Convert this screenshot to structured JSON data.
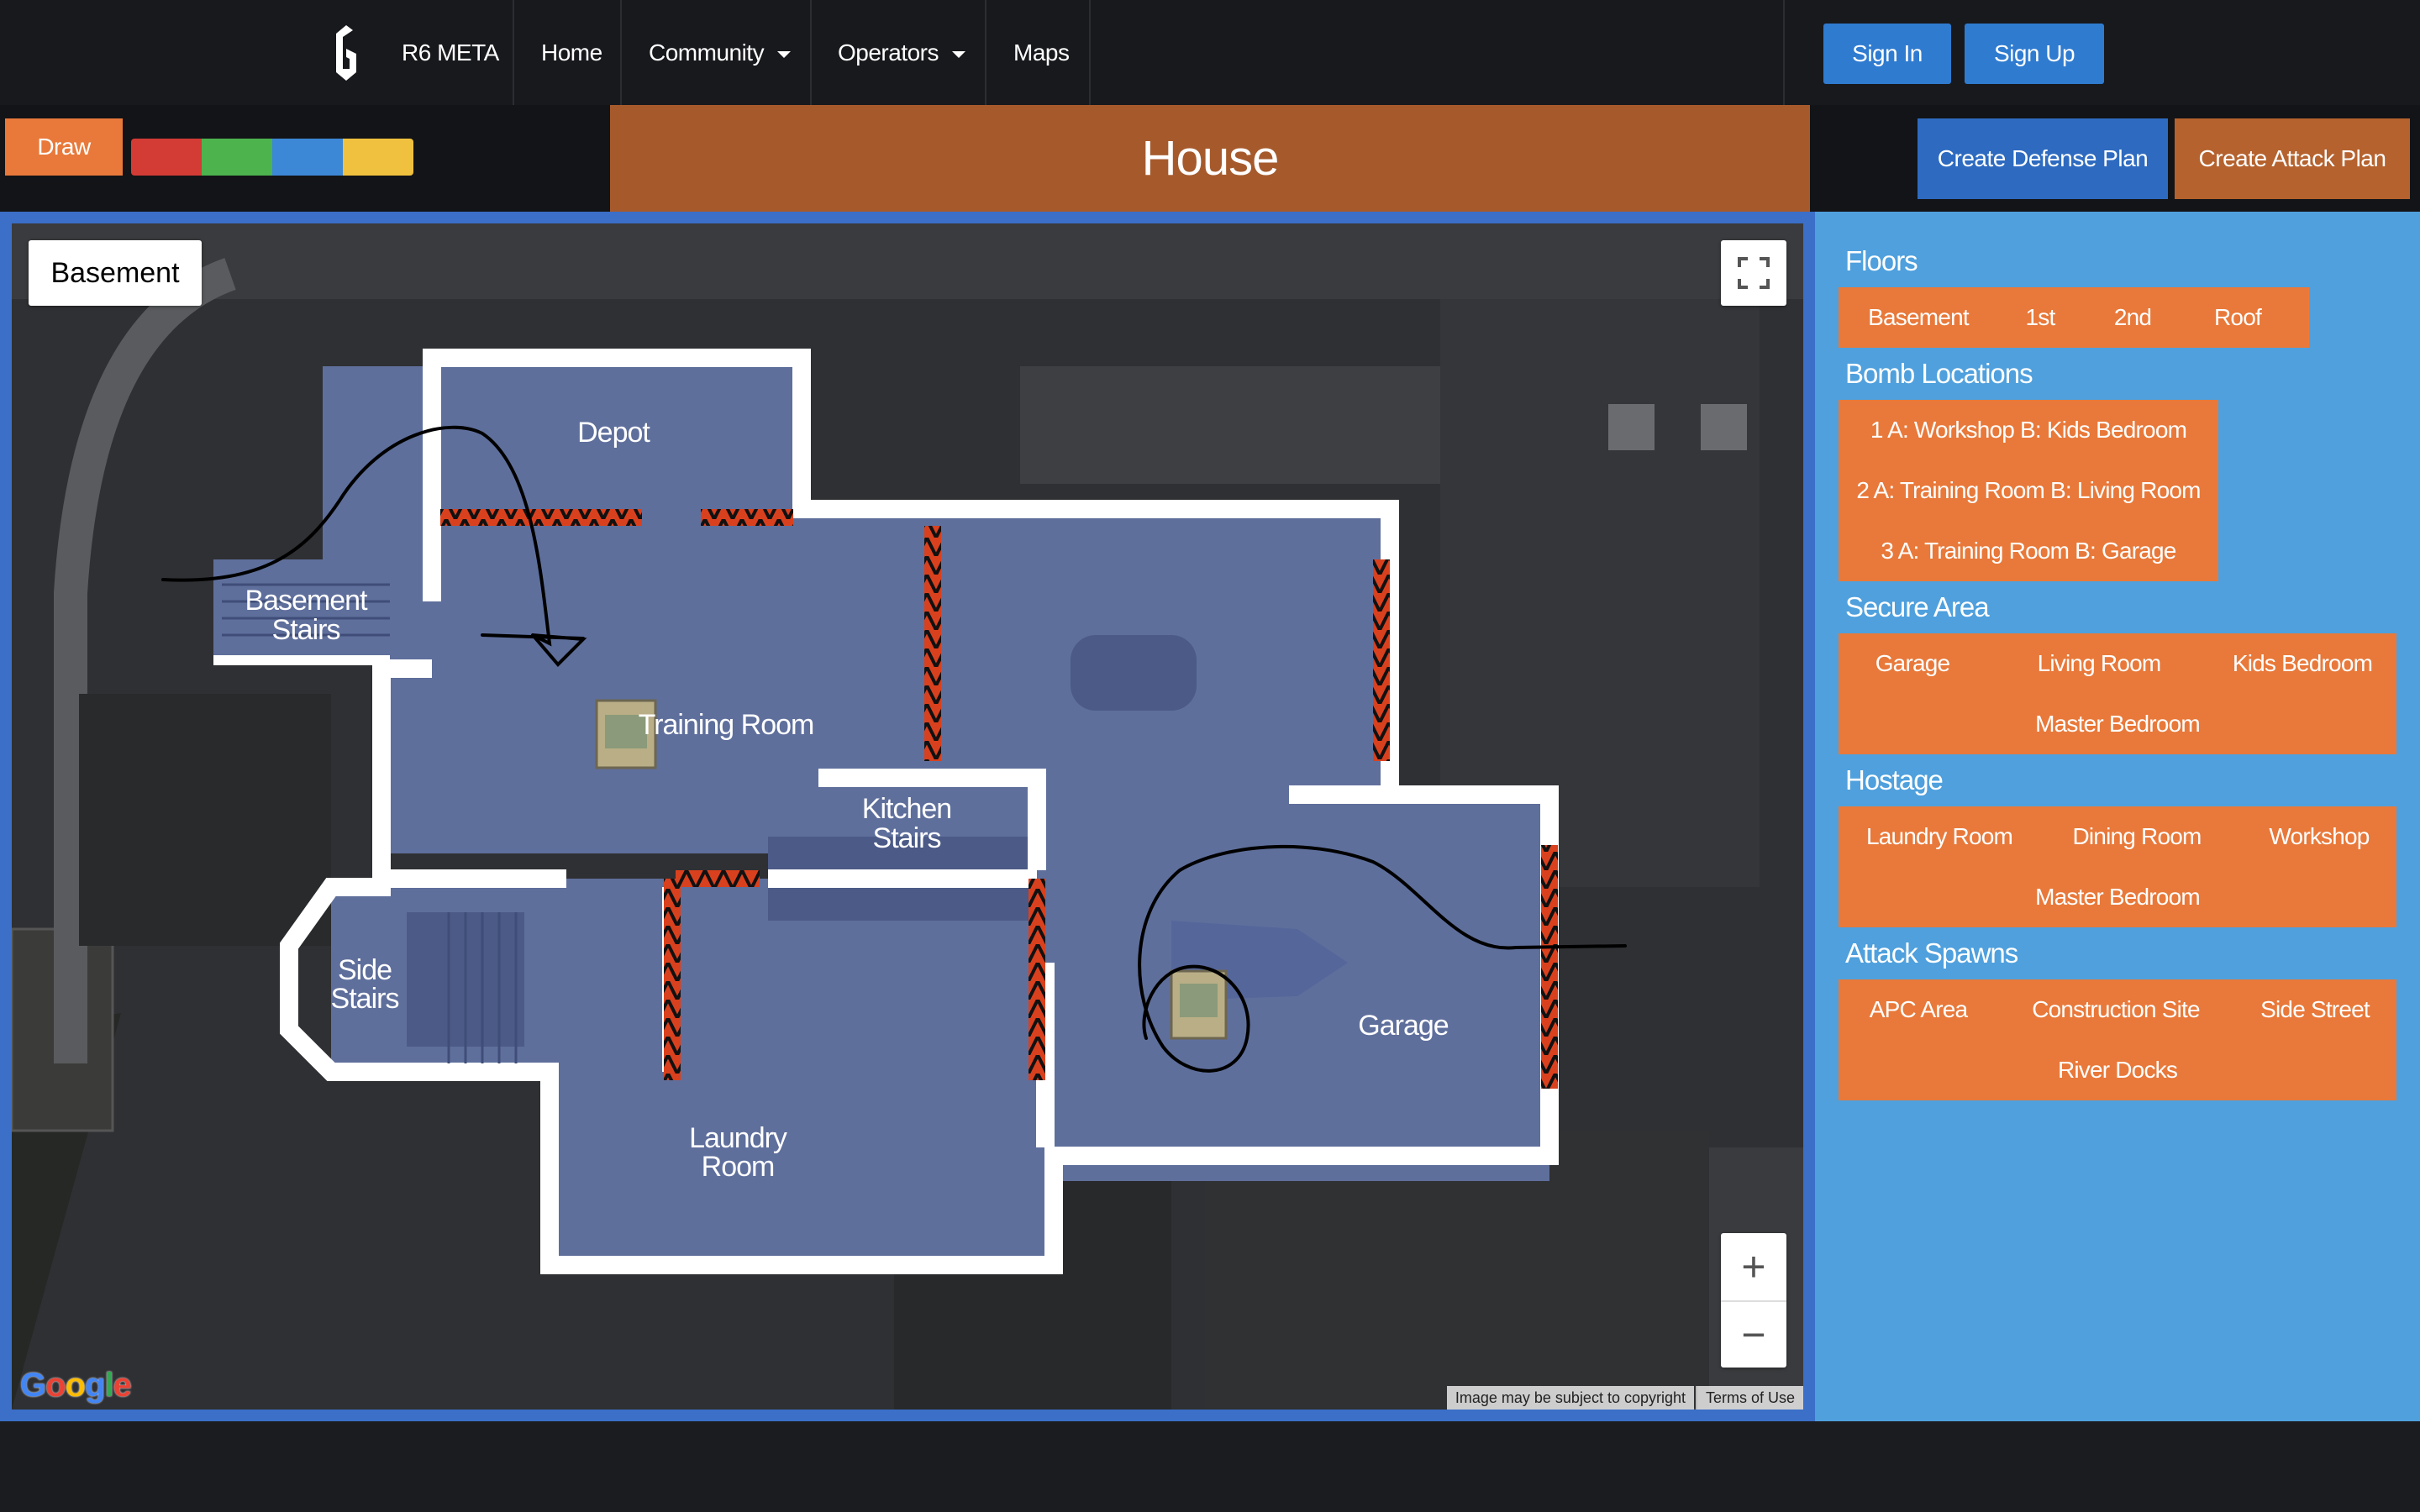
{
  "nav": {
    "brand": "R6 META",
    "links": [
      "Home",
      "Community",
      "Operators",
      "Maps"
    ],
    "sign_in": "Sign In",
    "sign_up": "Sign Up"
  },
  "toolbar": {
    "draw_label": "Draw",
    "palette": [
      "#d33b35",
      "#4db34d",
      "#3c87d6",
      "#f0c13e"
    ],
    "map_title": "House",
    "create_defense": "Create Defense Plan",
    "create_attack": "Create Attack Plan"
  },
  "map": {
    "current_floor": "Basement",
    "rooms": {
      "depot": "Depot",
      "basement_stairs": [
        "Basement",
        "Stairs"
      ],
      "training_room": "Training Room",
      "kitchen_stairs": [
        "Kitchen",
        "Stairs"
      ],
      "side_stairs": [
        "Side",
        "Stairs"
      ],
      "laundry_room": [
        "Laundry",
        "Room"
      ],
      "garage": "Garage"
    },
    "zoom_in": "+",
    "zoom_out": "−",
    "google": "Google",
    "copyright": "Image may be subject to copyright",
    "terms": "Terms of Use"
  },
  "sidebar": {
    "floors_title": "Floors",
    "floors": [
      "Basement",
      "1st",
      "2nd",
      "Roof"
    ],
    "bomb_title": "Bomb Locations",
    "bombs": [
      "1 A: Workshop B: Kids Bedroom",
      "2 A: Training Room B: Living Room",
      "3 A: Training Room B: Garage"
    ],
    "secure_title": "Secure Area",
    "secure": [
      "Garage",
      "Living Room",
      "Kids Bedroom",
      "Master Bedroom"
    ],
    "hostage_title": "Hostage",
    "hostage": [
      "Laundry Room",
      "Dining Room",
      "Workshop",
      "Master Bedroom"
    ],
    "spawns_title": "Attack Spawns",
    "spawns": [
      "APC Area",
      "Construction Site",
      "Side Street",
      "River Docks"
    ]
  },
  "colors": {
    "orange": "#e8793a",
    "banner": "#a65a2c",
    "blue_button": "#2f7bd0",
    "defense": "#2e6bc0",
    "attack": "#b5622e",
    "sidebar": "#4fa0dd"
  }
}
